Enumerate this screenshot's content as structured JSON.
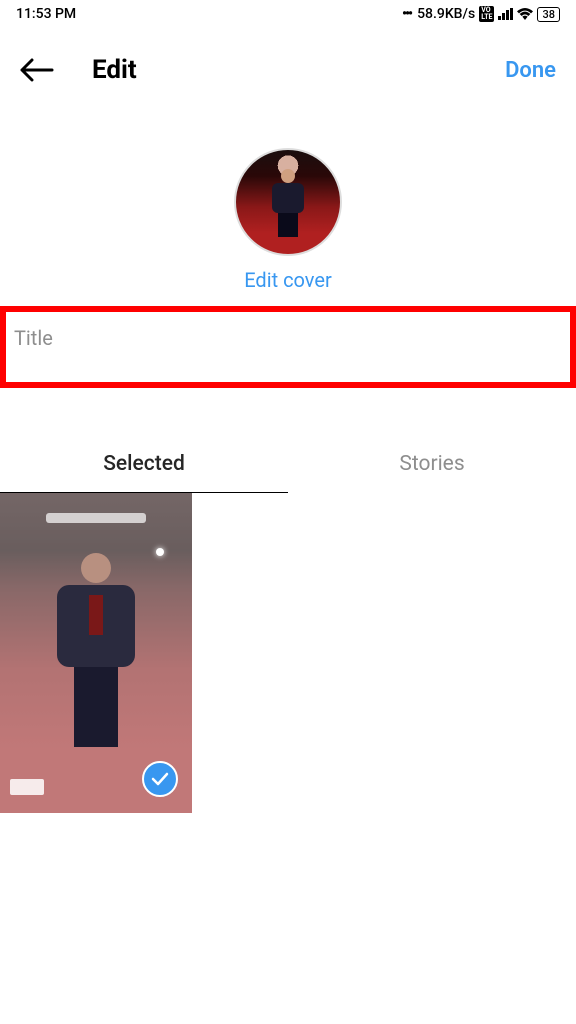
{
  "statusBar": {
    "time": "11:53 PM",
    "dots": "•••",
    "speed": "58.9KB/s",
    "volte": "VO\nLTE",
    "battery": "38"
  },
  "header": {
    "title": "Edit",
    "done": "Done"
  },
  "cover": {
    "editLink": "Edit cover"
  },
  "input": {
    "placeholder": "Title",
    "value": ""
  },
  "tabs": {
    "selected": "Selected",
    "stories": "Stories"
  }
}
